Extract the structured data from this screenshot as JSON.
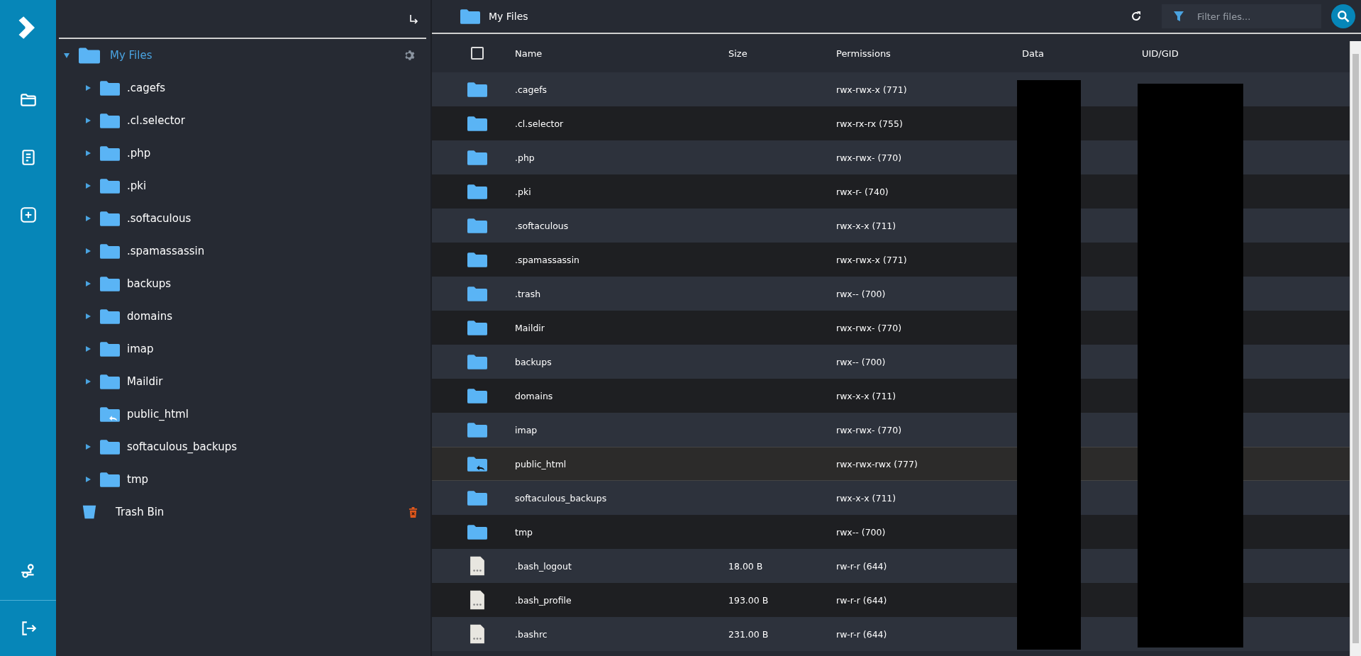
{
  "tree": {
    "root": {
      "label": "My Files",
      "expanded": true,
      "children": [
        {
          "label": ".cagefs",
          "kind": "folder"
        },
        {
          "label": ".cl.selector",
          "kind": "folder"
        },
        {
          "label": ".php",
          "kind": "folder"
        },
        {
          "label": ".pki",
          "kind": "folder"
        },
        {
          "label": ".softaculous",
          "kind": "folder"
        },
        {
          "label": ".spamassassin",
          "kind": "folder"
        },
        {
          "label": "backups",
          "kind": "folder"
        },
        {
          "label": "domains",
          "kind": "folder"
        },
        {
          "label": "imap",
          "kind": "folder"
        },
        {
          "label": "Maildir",
          "kind": "folder"
        },
        {
          "label": "public_html",
          "kind": "link"
        },
        {
          "label": "softaculous_backups",
          "kind": "folder"
        },
        {
          "label": "tmp",
          "kind": "folder"
        }
      ]
    },
    "trash": {
      "label": "Trash Bin"
    }
  },
  "header": {
    "title": "My Files",
    "filter": {
      "placeholder": "Filter files..."
    }
  },
  "table": {
    "select_all": {
      "checked": false
    },
    "columns": [
      "Name",
      "Size",
      "Permissions",
      "Data",
      "UID/GID"
    ],
    "rows": [
      {
        "kind": "folder",
        "name": ".cagefs",
        "size": "",
        "permissions": "rwx-rwx-x (771)",
        "selected": false
      },
      {
        "kind": "folder",
        "name": ".cl.selector",
        "size": "",
        "permissions": "rwx-rx-rx (755)",
        "selected": false
      },
      {
        "kind": "folder",
        "name": ".php",
        "size": "",
        "permissions": "rwx-rwx- (770)",
        "selected": false
      },
      {
        "kind": "folder",
        "name": ".pki",
        "size": "",
        "permissions": "rwx-r- (740)",
        "selected": false
      },
      {
        "kind": "folder",
        "name": ".softaculous",
        "size": "",
        "permissions": "rwx-x-x (711)",
        "selected": false
      },
      {
        "kind": "folder",
        "name": ".spamassassin",
        "size": "",
        "permissions": "rwx-rwx-x (771)",
        "selected": false
      },
      {
        "kind": "folder",
        "name": ".trash",
        "size": "",
        "permissions": "rwx-- (700)",
        "selected": false
      },
      {
        "kind": "folder",
        "name": "Maildir",
        "size": "",
        "permissions": "rwx-rwx- (770)",
        "selected": false
      },
      {
        "kind": "folder",
        "name": "backups",
        "size": "",
        "permissions": "rwx-- (700)",
        "selected": false
      },
      {
        "kind": "folder",
        "name": "domains",
        "size": "",
        "permissions": "rwx-x-x (711)",
        "selected": false
      },
      {
        "kind": "folder",
        "name": "imap",
        "size": "",
        "permissions": "rwx-rwx- (770)",
        "selected": false
      },
      {
        "kind": "link",
        "name": "public_html",
        "size": "",
        "permissions": "rwx-rwx-rwx (777)",
        "selected": true
      },
      {
        "kind": "folder",
        "name": "softaculous_backups",
        "size": "",
        "permissions": "rwx-x-x (711)",
        "selected": false
      },
      {
        "kind": "folder",
        "name": "tmp",
        "size": "",
        "permissions": "rwx-- (700)",
        "selected": false
      },
      {
        "kind": "file",
        "name": ".bash_logout",
        "size": "18.00 B",
        "permissions": "rw-r-r (644)",
        "selected": false
      },
      {
        "kind": "file",
        "name": ".bash_profile",
        "size": "193.00 B",
        "permissions": "rw-r-r (644)",
        "selected": false
      },
      {
        "kind": "file",
        "name": ".bashrc",
        "size": "231.00 B",
        "permissions": "rw-r-r (644)",
        "selected": false
      }
    ]
  }
}
